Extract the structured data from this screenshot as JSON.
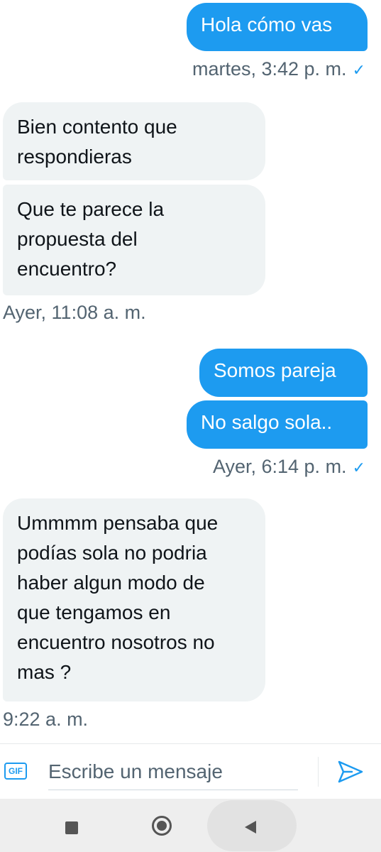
{
  "messages": [
    {
      "id": "m1",
      "direction": "sent",
      "text": "Hola cómo vas"
    },
    {
      "id": "m2",
      "direction": "received",
      "text": "Bien contento que\nrespondieras"
    },
    {
      "id": "m3",
      "direction": "received",
      "text": "Que te parece la\npropuesta del\nencuentro?"
    },
    {
      "id": "m4",
      "direction": "sent",
      "text": "Somos pareja"
    },
    {
      "id": "m5",
      "direction": "sent",
      "text": "No salgo sola.."
    },
    {
      "id": "m6",
      "direction": "received",
      "text": "Ummmm pensaba que\npodías sola no podria\nhaber algun modo de\nque tengamos en\nencuentro nosotros no\nmas ?"
    }
  ],
  "timestamps": {
    "t1": "martes, 3:42 p. m.",
    "t2": "Ayer, 11:08 a. m.",
    "t3": "Ayer, 6:14 p. m.",
    "t4": "9:22 a. m."
  },
  "read_mark": "✓",
  "composer": {
    "gif_label": "GIF",
    "placeholder": "Escribe un mensaje"
  },
  "colors": {
    "sent_bubble": "#1d9bf0",
    "received_bubble": "#eff3f4",
    "meta_text": "#536471"
  }
}
